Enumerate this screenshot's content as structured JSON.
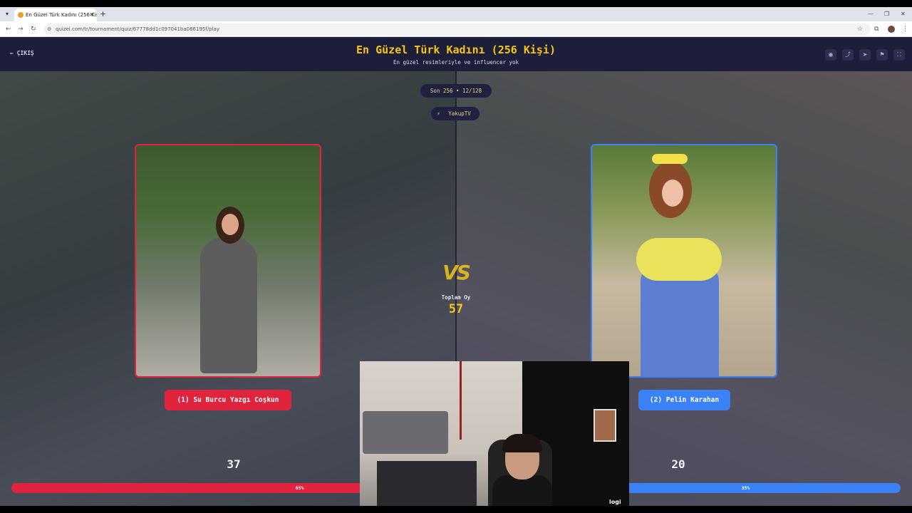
{
  "browser": {
    "tab_title": "En Güzel Türk Kadını (256 Kişi)",
    "url": "quizei.com/tr/tournament/quiz/67778dd1c097041ba086195f/play"
  },
  "header": {
    "exit_label": "ÇIKIŞ",
    "title": "En Güzel Türk Kadını (256 Kişi)",
    "subtitle": "En güzel resimleriyle ve influencer yok"
  },
  "match": {
    "round_label": "Son 256 • 12/128",
    "username": "YakupTV",
    "vs_label": "VS",
    "total_votes_label": "Toplam Oy",
    "total_votes": "57"
  },
  "left": {
    "name": "(1) Su Burcu Yazgı Coşkun",
    "votes": "37",
    "percent_label": "65%",
    "percent": 0.65,
    "color": "#e0243e"
  },
  "right": {
    "name": "(2) Pelin Karahan",
    "votes": "20",
    "percent_label": "35%",
    "percent": 0.35,
    "color": "#3b82f6"
  },
  "webcam": {
    "logo": "logi"
  },
  "icons": [
    "arrow-left-icon",
    "eye-icon",
    "share-icon",
    "send-icon",
    "flag-icon",
    "fullscreen-icon",
    "user-icon",
    "lightning-icon"
  ]
}
